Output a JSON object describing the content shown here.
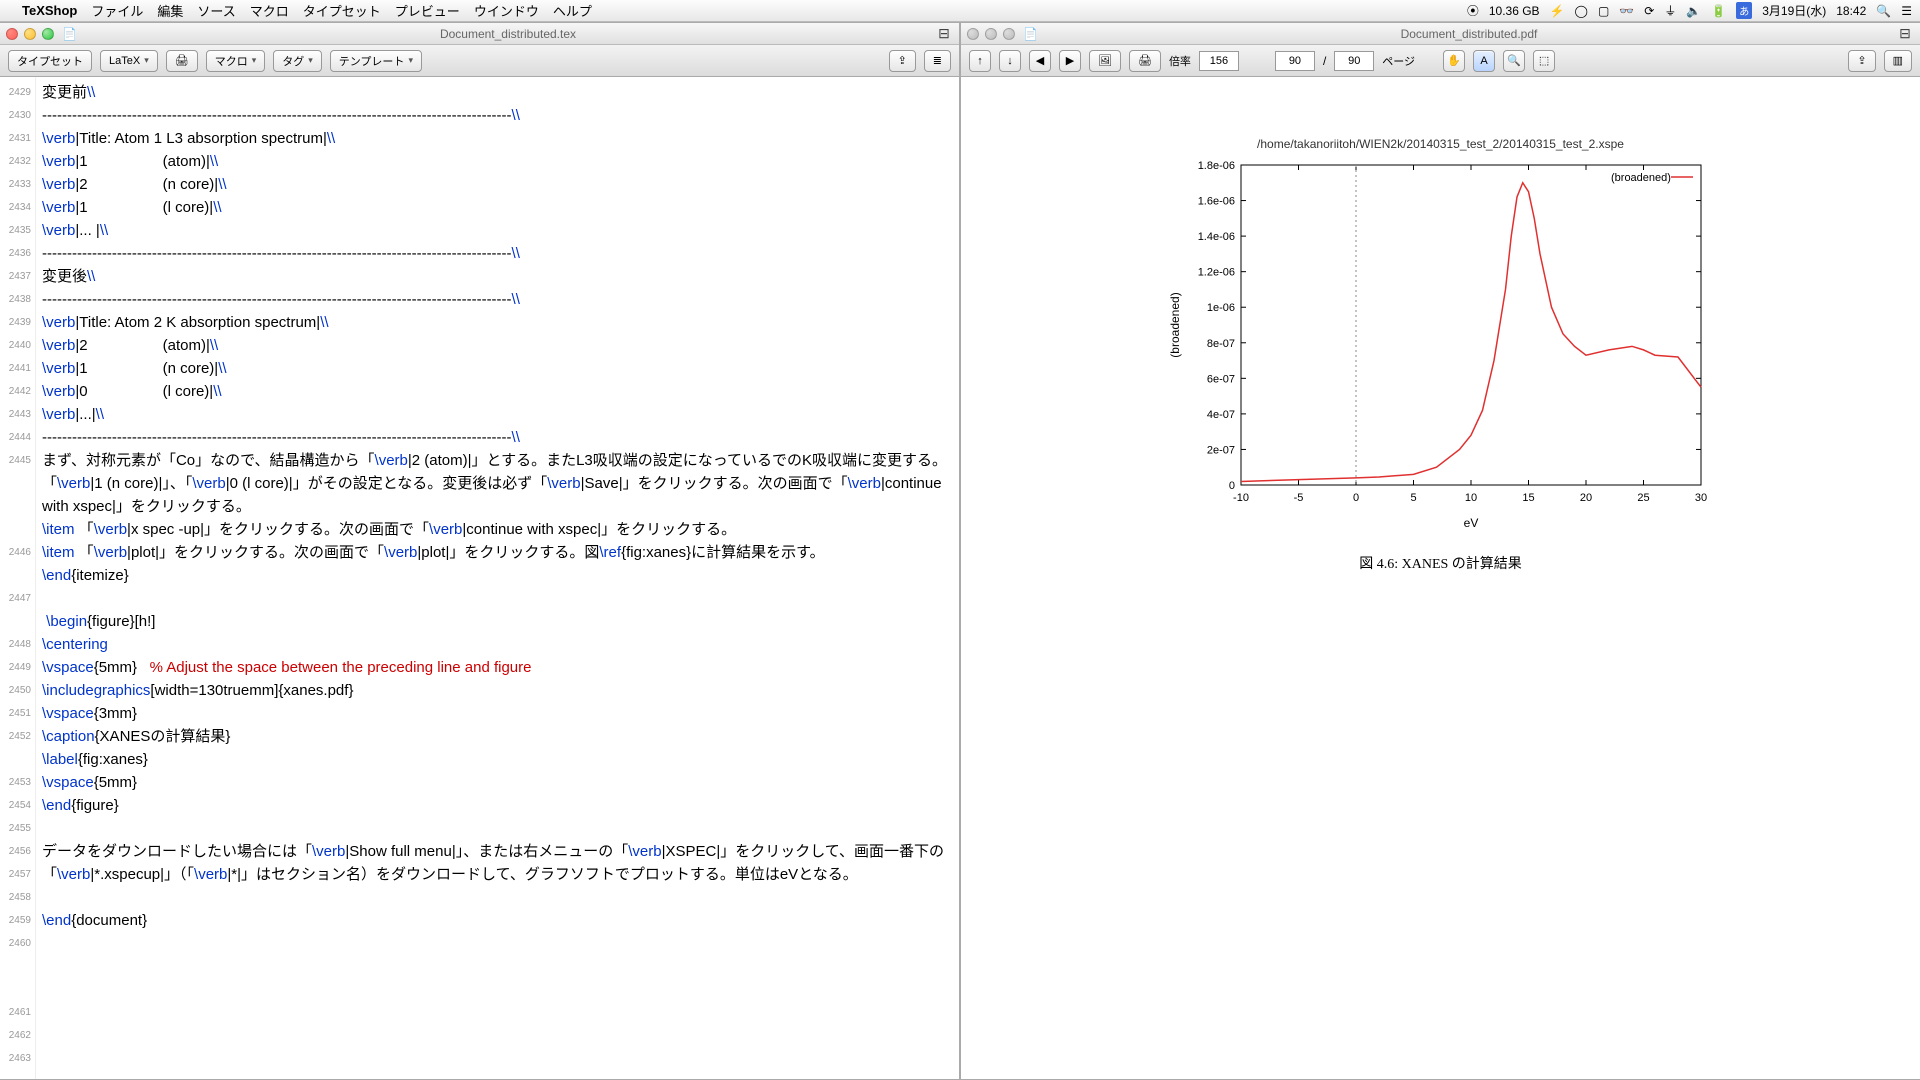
{
  "menubar": {
    "app": "TeXShop",
    "items": [
      "ファイル",
      "編集",
      "ソース",
      "マクロ",
      "タイプセット",
      "プレビュー",
      "ウインドウ",
      "ヘルプ"
    ],
    "status": {
      "disk": "10.36 GB",
      "date": "3月19日(水)",
      "time": "18:42"
    }
  },
  "left": {
    "title": "Document_distributed.tex",
    "toolbar": {
      "typeset": "タイプセット",
      "engine": "LaTeX",
      "macro": "マクロ",
      "tag": "タグ",
      "template": "テンプレート"
    },
    "first_line": 2429,
    "lines": [
      "変更前\\\\",
      "----------------------------------------------------------------------------------------------\\\\",
      "\\verb|Title: Atom 1 L3 absorption spectrum|\\\\",
      "\\verb|1                  (atom)|\\\\",
      "\\verb|2                  (n core)|\\\\",
      "\\verb|1                  (l core)|\\\\",
      "\\verb|... |\\\\",
      "----------------------------------------------------------------------------------------------\\\\",
      "変更後\\\\",
      "----------------------------------------------------------------------------------------------\\\\",
      "\\verb|Title: Atom 2 K absorption spectrum|\\\\",
      "\\verb|2                  (atom)|\\\\",
      "\\verb|1                  (n core)|\\\\",
      "\\verb|0                  (l core)|\\\\",
      "\\verb|...|\\\\",
      "----------------------------------------------------------------------------------------------\\\\",
      "まず、対称元素が「Co」なので、結晶構造から「\\verb|2 (atom)|」とする。またL3吸収端の設定になっているでのK吸収端に変更する。「\\verb|1 (n core)|」、「\\verb|0 (l core)|」がその設定となる。変更後は必ず「\\verb|Save|」をクリックする。次の画面で「\\verb|continue with xspec|」をクリックする。",
      "\\item 「\\verb|x spec -up|」をクリックする。次の画面で「\\verb|continue with xspec|」をクリックする。",
      "\\item 「\\verb|plot|」をクリックする。次の画面で「\\verb|plot|」をクリックする。図\\ref{fig:xanes}に計算結果を示す。",
      "\\end{itemize}",
      "",
      " \\begin{figure}[h!]",
      "\\centering",
      "\\vspace{5mm}   % Adjust the space between the preceding line and figure",
      "\\includegraphics[width=130truemm]{xanes.pdf}",
      "\\vspace{3mm}",
      "\\caption{XANESの計算結果}",
      "\\label{fig:xanes}",
      "\\vspace{5mm}",
      "\\end{figure}",
      "",
      "データをダウンロードしたい場合には「\\verb|Show full menu|」、または右メニューの「\\verb|XSPEC|」をクリックして、画面一番下の「\\verb|*.xspecup|」（「\\verb|*|」はセクション名）をダウンロードして、グラフソフトでプロットする。単位はeVとなる。",
      "",
      "\\end{document}",
      ""
    ]
  },
  "right": {
    "title": "Document_distributed.pdf",
    "toolbar": {
      "scale_label": "倍率",
      "scale": "156",
      "page": "90",
      "slash": "/",
      "pages": "90",
      "page_label": "ページ"
    },
    "figure": {
      "title_path": "/home/takanoriitoh/WIEN2k/20140315_test_2/20140315_test_2.xspe",
      "caption": "図 4.6: XANES の計算結果"
    }
  },
  "chart_data": {
    "type": "line",
    "title": "/home/takanoriitoh/WIEN2k/20140315_test_2/20140315_test_2.xspe",
    "xlabel": "eV",
    "ylabel": "(broadened)",
    "xlim": [
      -10,
      30
    ],
    "ylim": [
      0,
      1.8e-06
    ],
    "xticks": [
      -10,
      -5,
      0,
      5,
      10,
      15,
      20,
      25,
      30
    ],
    "yticks": [
      0,
      2e-07,
      4e-07,
      6e-07,
      8e-07,
      1e-06,
      1.2e-06,
      1.4e-06,
      1.6e-06,
      1.8e-06
    ],
    "ytick_labels": [
      "0",
      "2e-07",
      "4e-07",
      "6e-07",
      "8e-07",
      "1e-06",
      "1.2e-06",
      "1.4e-06",
      "1.6e-06",
      "1.8e-06"
    ],
    "series": [
      {
        "name": "(broadened)",
        "color": "#e03030",
        "x": [
          -10,
          -5,
          0,
          2,
          5,
          7,
          9,
          10,
          11,
          12,
          13,
          13.5,
          14,
          14.5,
          15,
          15.5,
          16,
          17,
          18,
          19,
          20,
          22,
          24,
          25,
          26,
          28,
          30
        ],
        "y": [
          2e-08,
          3e-08,
          4e-08,
          4.5e-08,
          6e-08,
          1e-07,
          2e-07,
          2.8e-07,
          4.2e-07,
          7e-07,
          1.1e-06,
          1.4e-06,
          1.62e-06,
          1.7e-06,
          1.65e-06,
          1.5e-06,
          1.3e-06,
          1e-06,
          8.5e-07,
          7.8e-07,
          7.3e-07,
          7.6e-07,
          7.8e-07,
          7.6e-07,
          7.3e-07,
          7.2e-07,
          5.5e-07
        ]
      }
    ]
  }
}
